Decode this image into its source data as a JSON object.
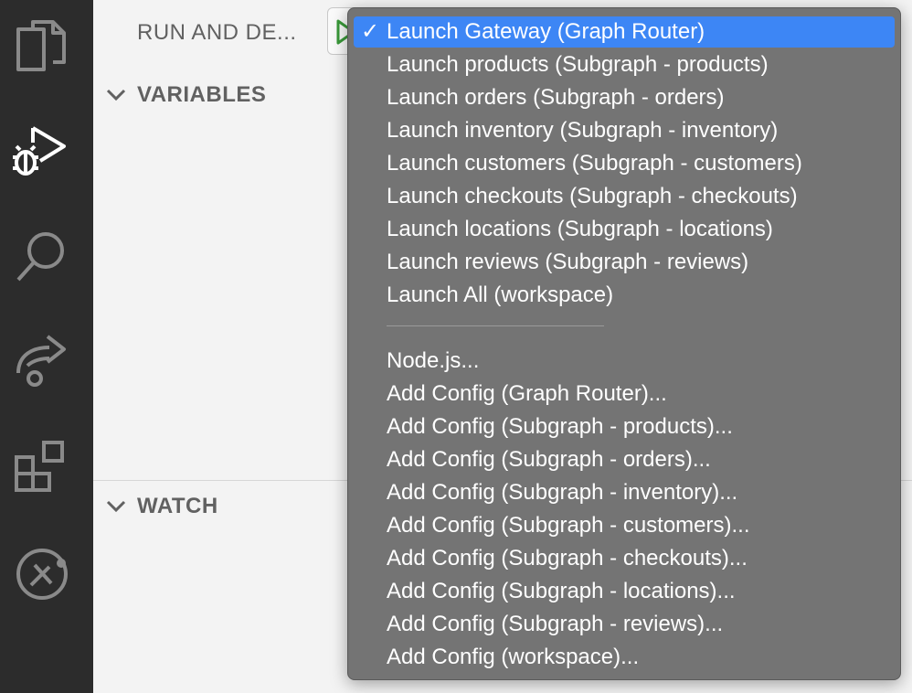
{
  "sidebar": {
    "title": "RUN AND DE...",
    "sections": {
      "variables": "VARIABLES",
      "watch": "WATCH"
    }
  },
  "activity_bar": {
    "icons": [
      "explorer-icon",
      "run-debug-icon",
      "search-icon",
      "remote-icon",
      "extensions-icon",
      "tools-icon"
    ]
  },
  "dropdown": {
    "selected_index": 0,
    "check_glyph": "✓",
    "launch_items": [
      "Launch Gateway (Graph Router)",
      "Launch products (Subgraph - products)",
      "Launch orders (Subgraph - orders)",
      "Launch inventory (Subgraph - inventory)",
      "Launch customers (Subgraph - customers)",
      "Launch checkouts (Subgraph - checkouts)",
      "Launch locations (Subgraph - locations)",
      "Launch reviews (Subgraph - reviews)",
      "Launch All (workspace)"
    ],
    "config_items": [
      "Node.js...",
      "Add Config (Graph Router)...",
      "Add Config (Subgraph - products)...",
      "Add Config (Subgraph - orders)...",
      "Add Config (Subgraph - inventory)...",
      "Add Config (Subgraph - customers)...",
      "Add Config (Subgraph - checkouts)...",
      "Add Config (Subgraph - locations)...",
      "Add Config (Subgraph - reviews)...",
      "Add Config (workspace)..."
    ]
  },
  "colors": {
    "selection": "#3d86f5",
    "menu_bg": "#747474",
    "activity_bg": "#2c2c2c",
    "run_green": "#3a9a3a"
  }
}
